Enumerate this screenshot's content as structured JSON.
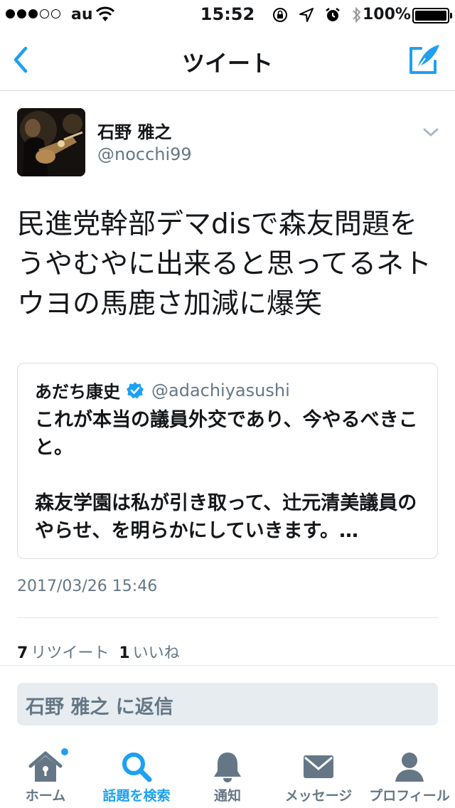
{
  "status_bar": {
    "signal_filled": 3,
    "signal_total": 5,
    "carrier": "au",
    "time": "15:52",
    "battery": "100%",
    "battery_level": 1.0,
    "icons": [
      "rotation-lock-icon",
      "location-icon",
      "alarm-icon",
      "bluetooth-icon"
    ]
  },
  "nav": {
    "title": "ツイート",
    "back_icon": "chevron-left-icon",
    "compose_icon": "compose-tweet-icon"
  },
  "tweet": {
    "author_name": "石野 雅之",
    "author_handle": "@nocchi99",
    "text": "民進党幹部デマdisで森友問題をうやむやに出来ると思ってるネトウヨの馬鹿さ加減に爆笑",
    "timestamp": "2017/03/26 15:46",
    "retweets_count": "7",
    "retweets_label": "リツイート",
    "likes_count": "1",
    "likes_label": "いいね"
  },
  "quoted_tweet": {
    "author_name": "あだち康史",
    "author_handle": "@adachiyasushi",
    "paragraph1": "これが本当の議員外交であり、今やるべきこと。",
    "paragraph2": "森友学園は私が引き取って、辻元清美議員のやらせ、を明らかにしていきます。…"
  },
  "reply": {
    "placeholder": "石野 雅之 に返信"
  },
  "tab_bar": {
    "active_tab": "search",
    "accent_color": "#1da1f2",
    "inactive_color": "#657786",
    "tabs": [
      {
        "id": "home",
        "label": "ホーム",
        "icon": "home-icon",
        "has_badge": true
      },
      {
        "id": "search",
        "label": "話題を検索",
        "icon": "search-icon"
      },
      {
        "id": "notifications",
        "label": "通知",
        "icon": "bell-icon"
      },
      {
        "id": "messages",
        "label": "メッセージ",
        "icon": "envelope-icon"
      },
      {
        "id": "profile",
        "label": "プロフィール",
        "icon": "person-icon"
      }
    ]
  }
}
